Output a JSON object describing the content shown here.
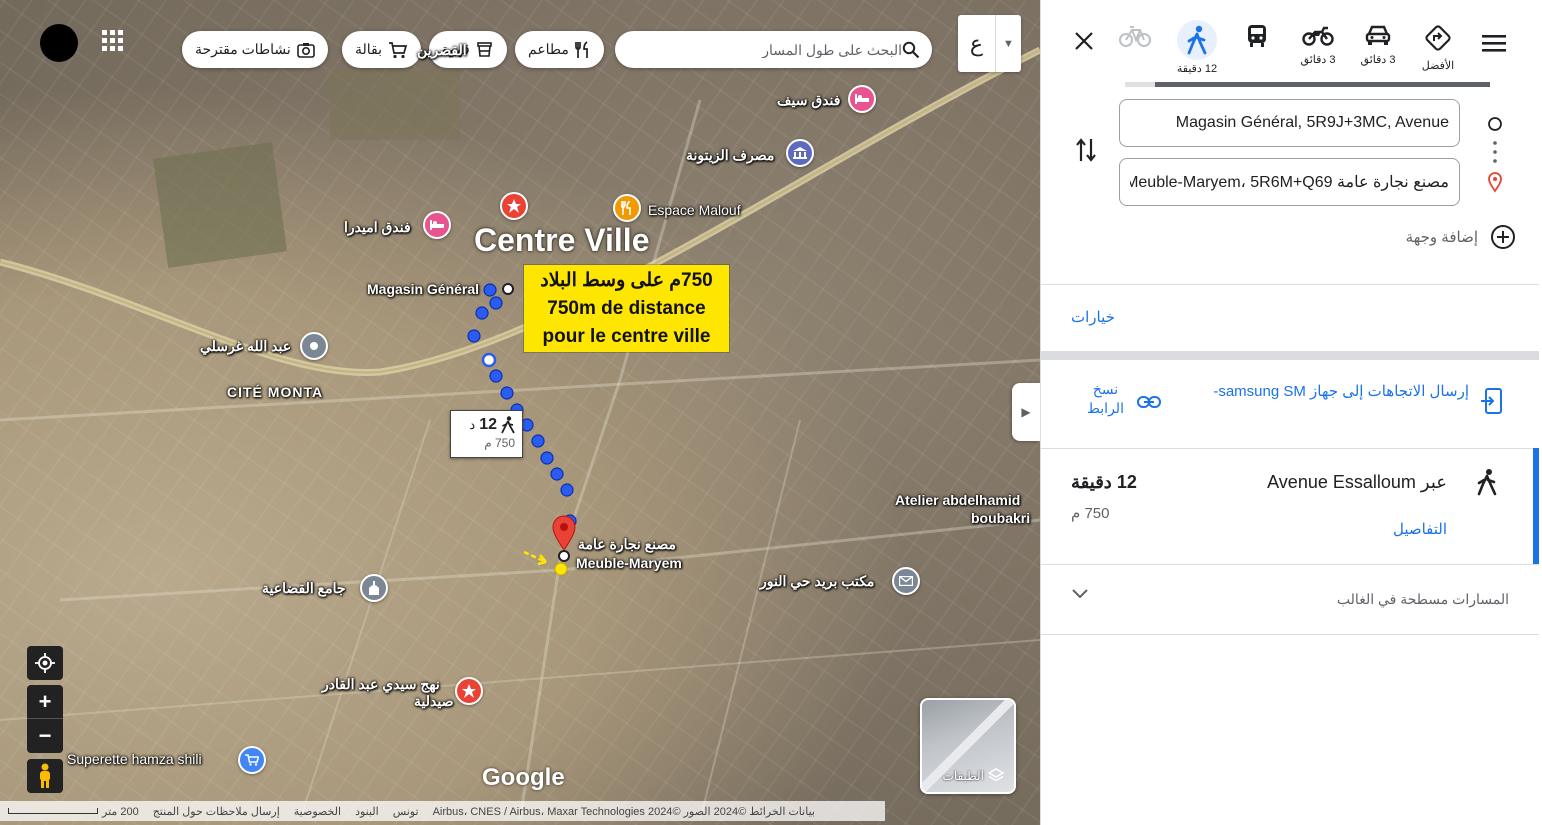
{
  "map": {
    "search_placeholder": "البحث على طول المسار",
    "lang_label": "ع",
    "chips": [
      {
        "label": "مطاعم",
        "icon": "restaurant-icon"
      },
      {
        "label": "قهوة",
        "icon": "coffee-icon"
      },
      {
        "label": "بقالة",
        "icon": "grocery-cart-icon"
      },
      {
        "label": "نشاطات مقترحة",
        "icon": "camera-icon"
      }
    ],
    "labels": {
      "centre_ville": "Centre Ville",
      "magasin_general": "Magasin Général",
      "espace_malouf": "Espace Malouf",
      "cite_monta": "CITÉ MONTA",
      "hotel_seif": "فندق سيف",
      "bank_zitouna": "مصرف الزيتونة",
      "hotel_amidra": "فندق اميدرا",
      "abdallah": "عبد الله غرسلي",
      "qasrin": "القصرين",
      "atelier_line1": "Atelier abdelhamid",
      "atelier_line2": "boubakri",
      "dest_ar": "مصنع نجارة عامة",
      "dest_fr": "Meuble-Maryem",
      "post_office": "مكتب بريد حي النور",
      "mosque": "جامع القضاعية",
      "pharmacy_line1": "نهج سيدي عبد القادر",
      "pharmacy_line2": "صيدلية",
      "superette": "Superette hamza shili"
    },
    "annotation": {
      "line1": "750م على وسط البلاد",
      "line2": "750m de distance",
      "line3": "pour le centre ville"
    },
    "route_box": {
      "time": "12",
      "unit": "د",
      "distance": "750 م"
    },
    "layers_label": "الطبقات",
    "google_logo": "Google",
    "footer": {
      "map_data": "بيانات الخرائط ©2024 الصور ©2024 Airbus، CNES / Airbus، Maxar Technologies",
      "tunisia": "تونس",
      "terms": "البنود",
      "privacy": "الخصوصية",
      "feedback": "إرسال ملاحظات حول المنتج",
      "scale": "200 متر"
    }
  },
  "panel": {
    "modes": [
      {
        "name": "best",
        "label": "الأفضل",
        "icon": "best-route-icon"
      },
      {
        "name": "car",
        "label": "3 دقائق",
        "icon": "car-icon"
      },
      {
        "name": "motorcycle",
        "label": "3 دقائق",
        "icon": "motorcycle-icon"
      },
      {
        "name": "transit",
        "label": "",
        "icon": "transit-icon"
      },
      {
        "name": "walk",
        "label": "12 دقيقة",
        "icon": "walking-icon",
        "active": true
      },
      {
        "name": "bike",
        "label": "",
        "icon": "bicycle-icon"
      }
    ],
    "origin_value": "Magasin Général, 5R9J+3MC, Avenue",
    "destination_value": "مصنع نجارة عامة Meuble-Maryem، 5R6M+Q69",
    "add_destination": "إضافة وجهة",
    "options": "خيارات",
    "send_directions": "إرسال الاتجاهات إلى جهاز samsung SM-",
    "copy_link_line1": "نسخ",
    "copy_link_line2": "الرابط",
    "route": {
      "via": "عبر Avenue Essalloum",
      "time": "12 دقيقة",
      "distance": "750 م",
      "details": "التفاصيل"
    },
    "alternate": "المسارات مسطحة في الغالب"
  },
  "colors": {
    "accent": "#1a73e8",
    "route_dot": "#2a5cf0",
    "annotation_bg": "#ffe600",
    "pin": "#ea4335"
  }
}
